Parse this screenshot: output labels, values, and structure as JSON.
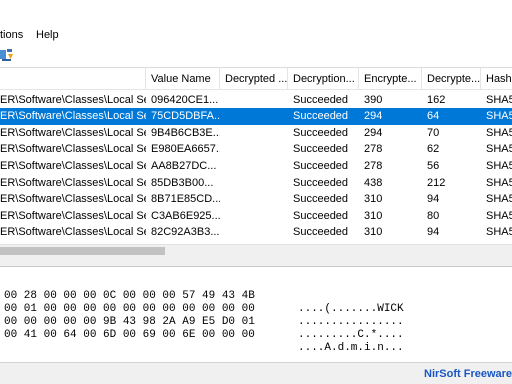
{
  "menu": {
    "items": [
      "tions",
      "Help"
    ]
  },
  "list": {
    "columns": [
      "Value Name",
      "Decrypted ...",
      "Decryption...",
      "Encrypte...",
      "Decrypte...",
      "Hash"
    ],
    "rows": [
      {
        "path": "ER\\Software\\Classes\\Local Se...",
        "value_name": "096420CE1...",
        "decrypted": "",
        "decryption": "Succeeded",
        "encrypted": "390",
        "decrypted_size": "162",
        "hash": "SHA5"
      },
      {
        "path": "ER\\Software\\Classes\\Local Se...",
        "value_name": "75CD5DBFA...",
        "decrypted": "",
        "decryption": "Succeeded",
        "encrypted": "294",
        "decrypted_size": "64",
        "hash": "SHA5",
        "selected": true
      },
      {
        "path": "ER\\Software\\Classes\\Local Se...",
        "value_name": "9B4B6CB3E...",
        "decrypted": "",
        "decryption": "Succeeded",
        "encrypted": "294",
        "decrypted_size": "70",
        "hash": "SHA5"
      },
      {
        "path": "ER\\Software\\Classes\\Local Se...",
        "value_name": "E980EA6657...",
        "decrypted": "",
        "decryption": "Succeeded",
        "encrypted": "278",
        "decrypted_size": "62",
        "hash": "SHA5"
      },
      {
        "path": "ER\\Software\\Classes\\Local Se...",
        "value_name": "AA8B27DC...",
        "decrypted": "",
        "decryption": "Succeeded",
        "encrypted": "278",
        "decrypted_size": "56",
        "hash": "SHA5"
      },
      {
        "path": "ER\\Software\\Classes\\Local Se...",
        "value_name": "85DB3B00...",
        "decrypted": "",
        "decryption": "Succeeded",
        "encrypted": "438",
        "decrypted_size": "212",
        "hash": "SHA5"
      },
      {
        "path": "ER\\Software\\Classes\\Local Se...",
        "value_name": "8B71E85CD...",
        "decrypted": "",
        "decryption": "Succeeded",
        "encrypted": "310",
        "decrypted_size": "94",
        "hash": "SHA5"
      },
      {
        "path": "ER\\Software\\Classes\\Local Se...",
        "value_name": "C3AB6E925...",
        "decrypted": "",
        "decryption": "Succeeded",
        "encrypted": "310",
        "decrypted_size": "80",
        "hash": "SHA5"
      },
      {
        "path": "ER\\Software\\Classes\\Local Se...",
        "value_name": "82C92A3B3...",
        "decrypted": "",
        "decryption": "Succeeded",
        "encrypted": "310",
        "decrypted_size": "94",
        "hash": "SHA5"
      }
    ]
  },
  "hex": {
    "lines": [
      {
        "bytes": "00 28 00 00 00 0C 00 00 00 57 49 43 4B",
        "ascii": "....(.......WICK"
      },
      {
        "bytes": "00 01 00 00 00 00 00 00 00 00 00 00 00",
        "ascii": "................"
      },
      {
        "bytes": "00 00 00 00 00 9B 43 98 2A A9 E5 D0 01",
        "ascii": ".........C.*...."
      },
      {
        "bytes": "00 41 00 64 00 6D 00 69 00 6E 00 00 00",
        "ascii": "....A.d.m.i.n..."
      }
    ]
  },
  "status": {
    "text": "NirSoft Freeware.  h"
  },
  "colors": {
    "selection": "#0078d7",
    "status_link": "#1a56c4"
  },
  "icons": {
    "toolbar": "toolbar-action-icon"
  }
}
